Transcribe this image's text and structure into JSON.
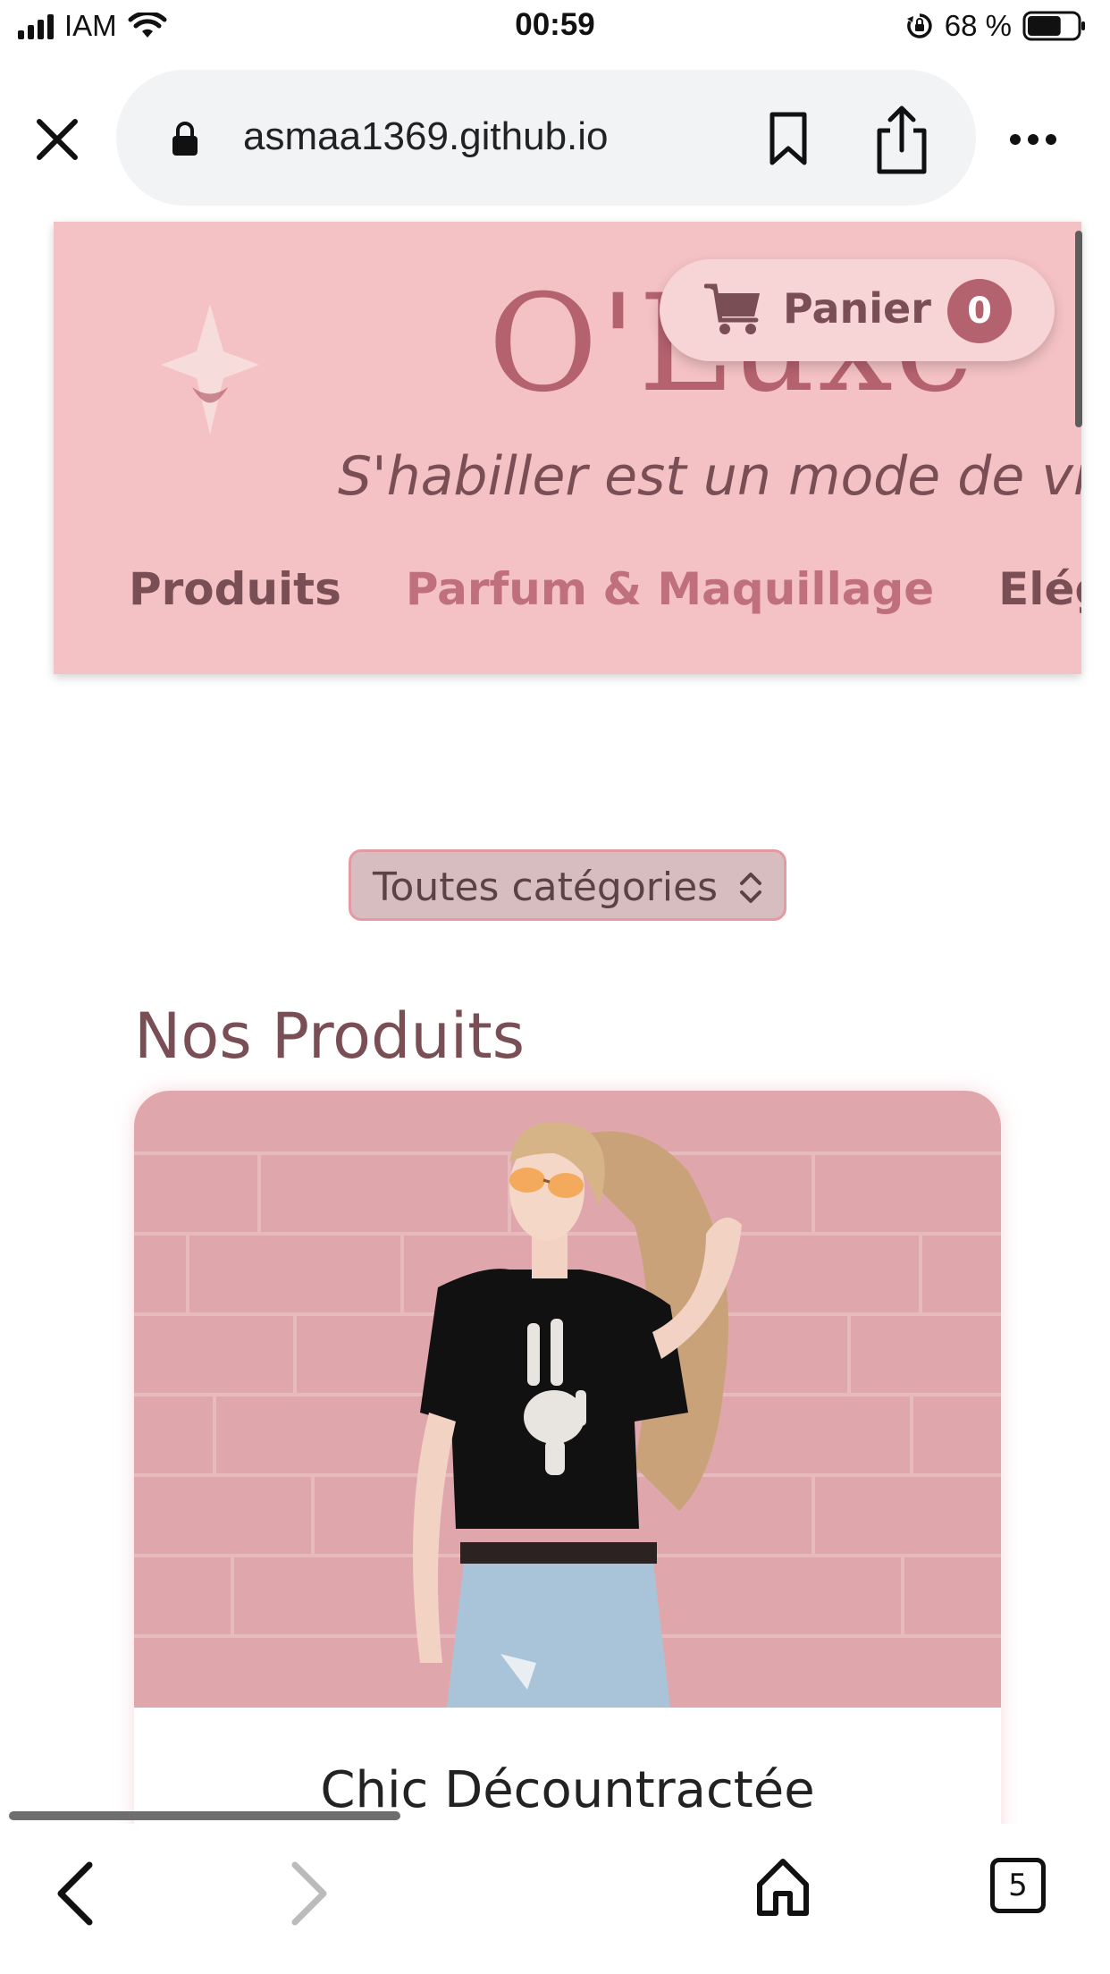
{
  "status_bar": {
    "carrier": "IAM",
    "time": "00:59",
    "battery": "68 %",
    "battery_level": 0.68
  },
  "browser": {
    "url": "asmaa1369.github.io",
    "tab_count": "5"
  },
  "site": {
    "brand": "O'Luxe",
    "slogan": "S'habiller est un mode de vie",
    "nav": [
      "Produits",
      "Parfum & Maquillage",
      "Elégance"
    ],
    "cart": {
      "label": "Panier",
      "count": "0"
    },
    "category_select": "Toutes catégories",
    "section_title": "Nos Produits",
    "product": {
      "name": "Chic Décountractée"
    }
  },
  "colors": {
    "header_bg": "#f4c2c4",
    "brand": "#b5626f",
    "text_dark": "#7a4e55"
  }
}
